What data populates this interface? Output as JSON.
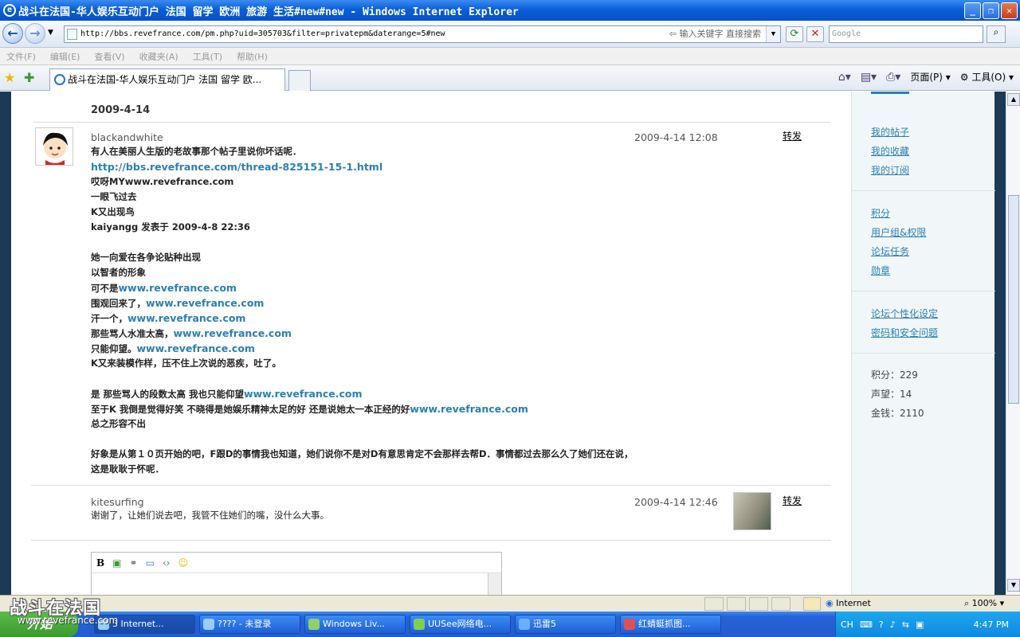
{
  "window": {
    "title": "战斗在法国-华人娱乐互动门户 法国 留学 欧洲 旅游 生活#new#new - Windows Internet Explorer"
  },
  "address": {
    "url": "http://bbs.revefrance.com/pm.php?uid=305703&filter=privatepm&daterange=5#new",
    "hint": "输入关键字 直接搜索",
    "search_placeholder": "Google"
  },
  "menu": [
    "文件(F)",
    "编辑(E)",
    "查看(V)",
    "收藏夹(A)",
    "工具(T)",
    "帮助(H)"
  ],
  "tab": {
    "label": "战斗在法国-华人娱乐互动门户 法国 留学 欧..."
  },
  "toolbar": {
    "page": "页面(P)",
    "tools": "工具(O)"
  },
  "thread": {
    "date_header": "2009-4-14",
    "messages": [
      {
        "user": "blackandwhite",
        "time": "2009-4-14 12:08",
        "forward": "转发",
        "lines": [
          {
            "t": "有人在美丽人生版的老故事那个帖子里说你坏话呢．"
          },
          {
            "link": "http://bbs.revefrance.com/thread-825151-15-1.html"
          },
          {
            "t": "哎呀MYwww.revefrance.com"
          },
          {
            "t": "一眼飞过去"
          },
          {
            "t": "K又出现鸟"
          },
          {
            "t": "kaiyangg 发表于  2009-4-8 22:36"
          },
          {
            "gap": true
          },
          {
            "t": "她一向爱在各争论贴种出现"
          },
          {
            "t": "以智者的形象"
          },
          {
            "t": "可不是",
            "link": "www.revefrance.com"
          },
          {
            "t": "围观回来了，",
            "link": "www.revefrance.com"
          },
          {
            "t": "汗一个，",
            "link": "www.revefrance.com"
          },
          {
            "t": "那些骂人水准太高，",
            "link": "www.revefrance.com"
          },
          {
            "t": "只能仰望。",
            "link": "www.revefrance.com"
          },
          {
            "t": "K又来装模作样，压不住上次说的恶疾，吐了。"
          },
          {
            "gap": true
          },
          {
            "t": "是  那些骂人的段数太高  我也只能仰望",
            "link": "www.revefrance.com"
          },
          {
            "t": "至于K 我倒是觉得好笑  不晓得是她娱乐精神太足的好  还是说她太一本正经的好",
            "link": "www.revefrance.com"
          },
          {
            "t": "总之形容不出"
          },
          {
            "gap": true
          },
          {
            "t": "好象是从第１０页开始的吧，F跟D的事情我也知道，她们说你不是对D有意思肯定不会那样去帮D．事情都过去那么久了她们还在说，"
          },
          {
            "t": "这是耿耿于怀呢．"
          }
        ]
      },
      {
        "user": "kitesurfing",
        "time": "2009-4-14 12:46",
        "forward": "转发",
        "lines": [
          {
            "t": "谢谢了，让她们说去吧，我管不住她们的嘴，没什么大事。"
          }
        ]
      }
    ]
  },
  "editor": {
    "bold": "B"
  },
  "sidebar": {
    "group1": [
      "我的帖子",
      "我的收藏",
      "我的订阅"
    ],
    "group2": [
      "积分",
      "用户组&权限",
      "论坛任务",
      "勋章"
    ],
    "group3": [
      "论坛个性化设定",
      "密码和安全问题"
    ],
    "stats": [
      "积分：229",
      "声望：14",
      "金钱：2110"
    ]
  },
  "status": {
    "zone": "Internet",
    "zoom": "100%"
  },
  "watermark": {
    "title": "战斗在法国",
    "url": "www.revefrance.com"
  },
  "taskbar": {
    "start": "开始",
    "tasks": [
      "5 Internet...",
      "???? - 未登录",
      "Windows Liv...",
      "UUSee网络电...",
      "迅雷5",
      "红蜻蜓抓图..."
    ],
    "lang": "CH",
    "clock": "4:47 PM"
  }
}
